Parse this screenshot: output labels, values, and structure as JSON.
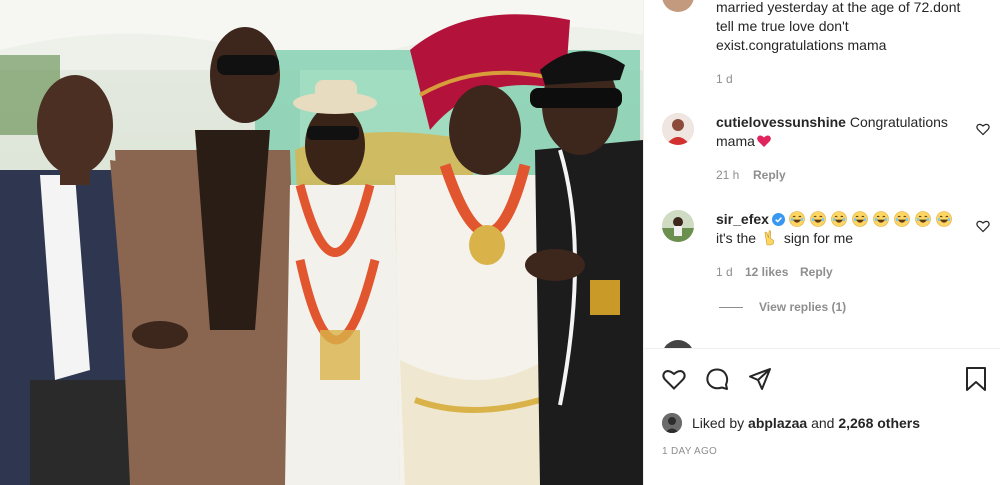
{
  "caption": {
    "text_line1": "married yesterday at the age of 72.dont",
    "text_line2": "tell me true love don't",
    "text_line3": "exist.congratulations mama",
    "age": "1 d"
  },
  "comments": [
    {
      "username": "cutielovessunshine",
      "text_a": "Congratulations",
      "text_b": "mama",
      "age": "21 h",
      "reply_label": "Reply"
    },
    {
      "username": "sir_efex",
      "verified": true,
      "emoji_count": 8,
      "text_b": "it's the",
      "text_c": "sign for me",
      "age": "1 d",
      "likes": "12 likes",
      "reply_label": "Reply",
      "view_replies": "View replies (1)"
    }
  ],
  "likes": {
    "prefix": "Liked by",
    "user": "abplazaa",
    "joiner": "and",
    "others": "2,268 others"
  },
  "post_date": "1 DAY AGO",
  "icons": [
    "heart-icon",
    "comment-icon",
    "share-icon",
    "bookmark-icon",
    "verified-icon",
    "laughing-emoji-icon",
    "red-heart-emoji-icon",
    "peace-hand-emoji-icon"
  ],
  "colors": {
    "verified": "#3897f0",
    "heart": "#e0245e",
    "muted": "#8e8e8e"
  }
}
